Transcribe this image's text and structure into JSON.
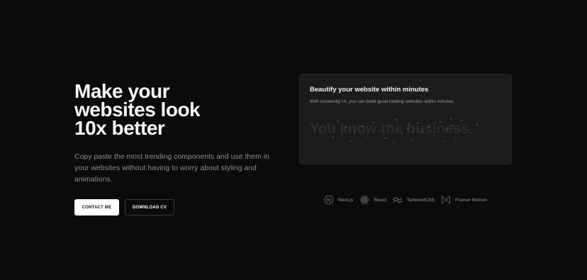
{
  "hero": {
    "title_lines": [
      "Make your",
      "websites look",
      "10x better"
    ],
    "subtitle": "Copy paste the most trending components and use them in your websites without having to worry about styling and animations.",
    "primary_button": "CONTACT ME",
    "secondary_button": "DOWNLOAD CV"
  },
  "card": {
    "title": "Beautify your website within minutes",
    "description": "With Aceternity UI, you can build great looking websites within minutes.",
    "effect_text": "You know the business"
  },
  "tech": [
    {
      "label": "Next.js",
      "icon": "nextjs-icon"
    },
    {
      "label": "React",
      "icon": "react-icon"
    },
    {
      "label": "TailwindCSS",
      "icon": "tailwind-icon"
    },
    {
      "label": "Framer Motion",
      "icon": "framer-motion-icon"
    }
  ],
  "colors": {
    "background": "#0b0b0c",
    "card": "#1c1c1f",
    "text_muted": "#8b8b90"
  }
}
